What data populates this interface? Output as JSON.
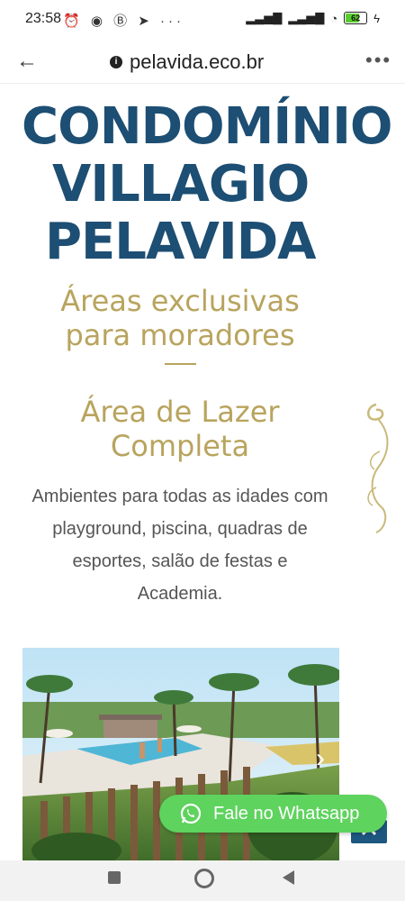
{
  "status_bar": {
    "time": "23:58",
    "battery": "62"
  },
  "browser": {
    "url": "pelavida.eco.br"
  },
  "hero": {
    "title_lines": [
      "CONDOMÍNIO",
      "VILLAGIO",
      "PELAVIDA"
    ],
    "subtitle_line1": "Áreas exclusivas",
    "subtitle_line2": "para moradores"
  },
  "section": {
    "heading_line1": "Área de Lazer",
    "heading_line2": "Completa",
    "description_lines": [
      "Ambientes para todas as idades com",
      "playground, piscina, quadras de",
      "esportes, salão de festas e",
      "Academia."
    ]
  },
  "whatsapp": {
    "label": "Fale no Whatsapp"
  },
  "colors": {
    "primary": "#1d4e73",
    "gold": "#b8a45e",
    "whatsapp": "#5ed35e"
  }
}
